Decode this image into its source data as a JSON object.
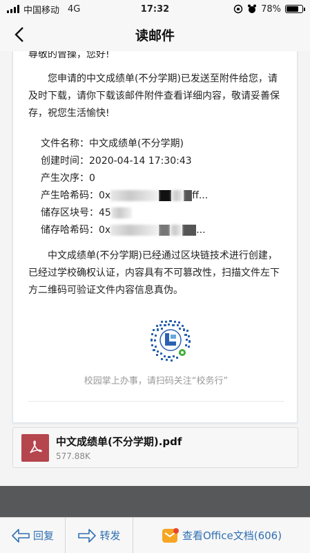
{
  "status_bar": {
    "carrier": "中国移动",
    "network": "4G",
    "time": "17:32",
    "battery": "78%"
  },
  "nav": {
    "title": "读邮件"
  },
  "email": {
    "greeting": "尊敬的曾操，您好!",
    "intro": "您申请的中文成绩单(不分学期)已发送至附件给您，请及时下载，请你下载该邮件附件查看详细内容，敬请妥善保存，祝您生活愉快!",
    "info": {
      "file_name_label": "文件名称：",
      "file_name_value": "中文成绩单(不分学期)",
      "created_label": "创建时间：",
      "created_value": "2020-04-14 17:30:43",
      "seq_label": "产生次序：",
      "seq_value": "0",
      "hash_label": "产生哈希码：",
      "hash_prefix": "0x",
      "hash_suffix": "ff...",
      "block_label": "储存区块号：",
      "block_prefix": "45",
      "store_hash_label": "储存哈希码：",
      "store_hash_prefix": "0x",
      "store_hash_suffix": "..."
    },
    "blockchain_text": "中文成绩单(不分学期)已经通过区块链技术进行创建，已经过学校确权认证，内容具有不可篡改性，扫描文件左下方二维码可验证文件内容信息真伪。",
    "qr_caption": "校园掌上办事，请扫码关注“校务行”"
  },
  "attachment": {
    "name": "中文成绩单(不分学期).pdf",
    "size": "577.88K"
  },
  "toolbar": {
    "reply": "回复",
    "forward": "转发",
    "view_office": "查看Office文档(606)"
  },
  "colors": {
    "accent": "#2f6fb3",
    "pdf_icon": "#b5464e",
    "dark_bar": "#57585a"
  }
}
